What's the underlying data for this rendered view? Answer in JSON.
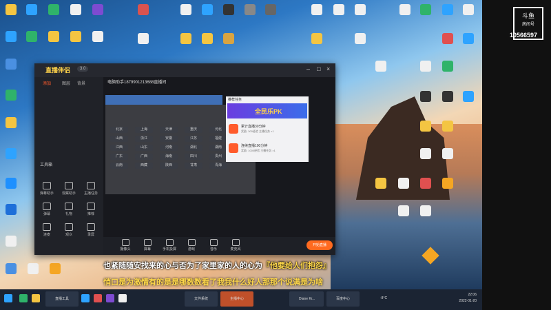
{
  "douyu_logo": "斗鱼",
  "douyu_room_label": "房间号",
  "room_number": "10566597",
  "desktop_icons": [
    {
      "label": "图标"
    },
    {
      "label": "图标"
    },
    {
      "label": "图标"
    },
    {
      "label": "图标"
    },
    {
      "label": "图标"
    },
    {
      "label": "图标"
    },
    {
      "label": "图标"
    },
    {
      "label": "图标"
    }
  ],
  "app": {
    "name": "直播伴侣",
    "version": "3.0",
    "title": "电脑助手1879901213688直播间",
    "sidebar_tabs": [
      "添加",
      "图层",
      "背景"
    ],
    "toolbox_label": "工具箱",
    "tools": [
      "弹幕助手",
      "观察助手",
      "主播任务",
      "弹幕",
      "礼物",
      "推荐",
      "连麦",
      "观众",
      "录屏"
    ],
    "pk_title": "推荐任务",
    "pk_banner": "全民乐PK",
    "tasks": [
      {
        "title": "累计直播30分钟",
        "desc": "奖励: 300经验 主播任务 ×1"
      },
      {
        "title": "连续直播100分钟",
        "desc": "奖励: 1000经验 主播任务 ×1"
      }
    ],
    "bottom_tools": [
      "摄像头",
      "屏幕",
      "手机投屏",
      "游戏",
      "音乐",
      "麦克风"
    ],
    "start_button": "开始直播",
    "cities": [
      "北京",
      "上海",
      "天津",
      "重庆",
      "河北",
      "山西",
      "浙江",
      "安徽",
      "江苏",
      "福建",
      "江西",
      "山东",
      "河南",
      "湖北",
      "湖南",
      "广东",
      "广西",
      "海南",
      "四川",
      "贵州",
      "云南",
      "西藏",
      "陕西",
      "甘肃",
      "青海"
    ]
  },
  "subtitle_line1_prefix": "也紧随随安找来的心与否为了家里家的人的心为",
  "subtitle_line1_highlight": "『他要给人们抱怨』",
  "subtitle_line2": "悄口是为激情有的是是哪数数看了我我什么好人那那个说满是为啥",
  "taskbar": {
    "items": [
      "直播工具",
      "文件系统",
      "主播中心",
      "Diane Kr...",
      "百度中心"
    ],
    "weather": "-8°C",
    "time": "22:06",
    "date": "2022-01-20"
  }
}
